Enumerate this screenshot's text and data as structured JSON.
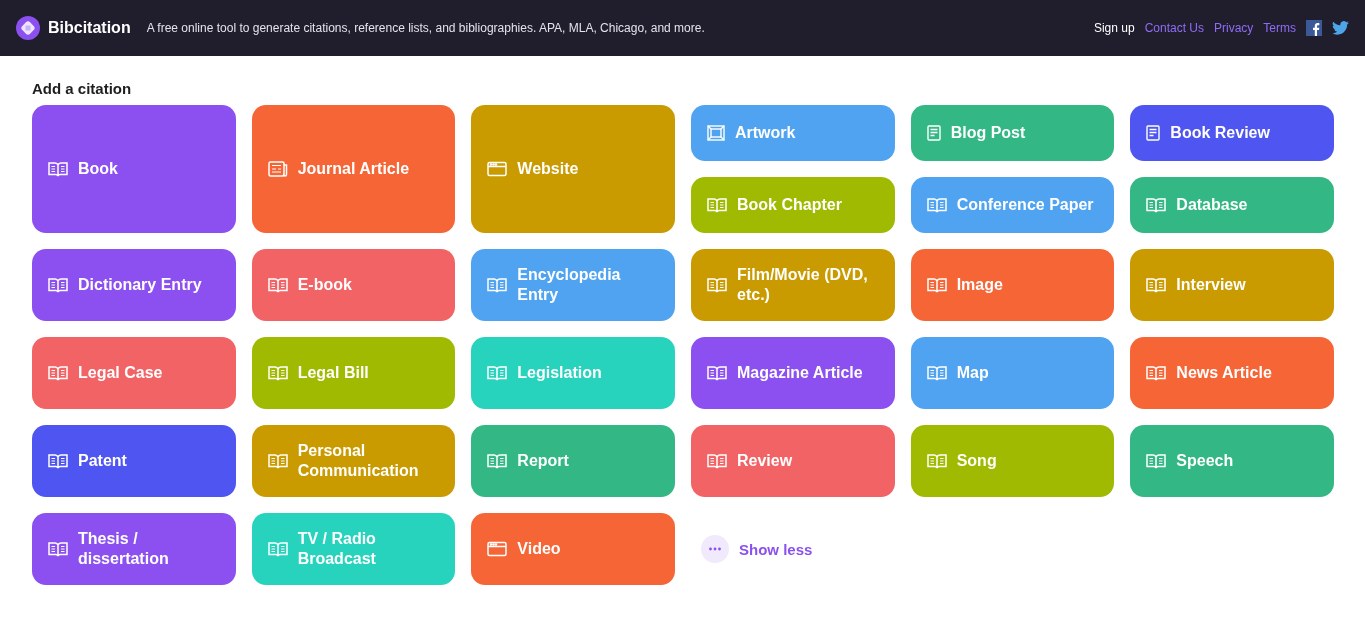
{
  "header": {
    "brand": "Bibcitation",
    "tagline": "A free online tool to generate citations, reference lists, and bibliographies. APA, MLA, Chicago, and more.",
    "links": [
      {
        "label": "Sign up",
        "kind": "plain"
      },
      {
        "label": "Contact Us",
        "kind": "accent"
      },
      {
        "label": "Privacy",
        "kind": "accent"
      },
      {
        "label": "Terms",
        "kind": "accent"
      }
    ]
  },
  "section_title": "Add a citation",
  "citation_types": [
    {
      "label": "Book",
      "kind": "book",
      "color": "#8b50ef",
      "large": true
    },
    {
      "label": "Journal Article",
      "kind": "newspaper",
      "color": "#f66536",
      "large": true
    },
    {
      "label": "Website",
      "kind": "browser",
      "color": "#c99b00",
      "large": true
    },
    {
      "label": "Artwork",
      "kind": "frame",
      "color": "#4fa3f0",
      "large": false
    },
    {
      "label": "Blog Post",
      "kind": "document",
      "color": "#33b784",
      "large": false
    },
    {
      "label": "Book Review",
      "kind": "document",
      "color": "#4f55f0",
      "large": false
    },
    {
      "label": "Book Chapter",
      "kind": "book",
      "color": "#9fba00",
      "large": false
    },
    {
      "label": "Conference Paper",
      "kind": "book",
      "color": "#4fa3f0",
      "large": false
    },
    {
      "label": "Database",
      "kind": "book",
      "color": "#33b784",
      "large": false
    },
    {
      "label": "Dictionary Entry",
      "kind": "book",
      "color": "#8b50ef",
      "large": false
    },
    {
      "label": "E-book",
      "kind": "book",
      "color": "#f26366",
      "large": false
    },
    {
      "label": "Encyclopedia Entry",
      "kind": "book",
      "color": "#4fa3f0",
      "large": false
    },
    {
      "label": "Film/Movie (DVD, etc.)",
      "kind": "book",
      "color": "#c99b00",
      "large": false
    },
    {
      "label": "Image",
      "kind": "book",
      "color": "#f66536",
      "large": false
    },
    {
      "label": "Interview",
      "kind": "book",
      "color": "#c99b00",
      "large": false
    },
    {
      "label": "Legal Case",
      "kind": "book",
      "color": "#f26366",
      "large": false
    },
    {
      "label": "Legal Bill",
      "kind": "book",
      "color": "#9fba00",
      "large": false
    },
    {
      "label": "Legislation",
      "kind": "book",
      "color": "#27d3bd",
      "large": false
    },
    {
      "label": "Magazine Article",
      "kind": "book",
      "color": "#8b50ef",
      "large": false
    },
    {
      "label": "Map",
      "kind": "book",
      "color": "#4fa3f0",
      "large": false
    },
    {
      "label": "News Article",
      "kind": "book",
      "color": "#f66536",
      "large": false
    },
    {
      "label": "Patent",
      "kind": "book",
      "color": "#4f55f0",
      "large": false
    },
    {
      "label": "Personal Communication",
      "kind": "book",
      "color": "#c99b00",
      "large": false
    },
    {
      "label": "Report",
      "kind": "book",
      "color": "#33b784",
      "large": false
    },
    {
      "label": "Review",
      "kind": "book",
      "color": "#f26366",
      "large": false
    },
    {
      "label": "Song",
      "kind": "book",
      "color": "#9fba00",
      "large": false
    },
    {
      "label": "Speech",
      "kind": "book",
      "color": "#33b784",
      "large": false
    },
    {
      "label": "Thesis / dissertation",
      "kind": "book",
      "color": "#8b50ef",
      "large": false
    },
    {
      "label": "TV / Radio Broadcast",
      "kind": "book",
      "color": "#27d3bd",
      "large": false
    },
    {
      "label": "Video",
      "kind": "browser",
      "color": "#f66536",
      "large": false
    }
  ],
  "toggle": {
    "label": "Show less"
  }
}
